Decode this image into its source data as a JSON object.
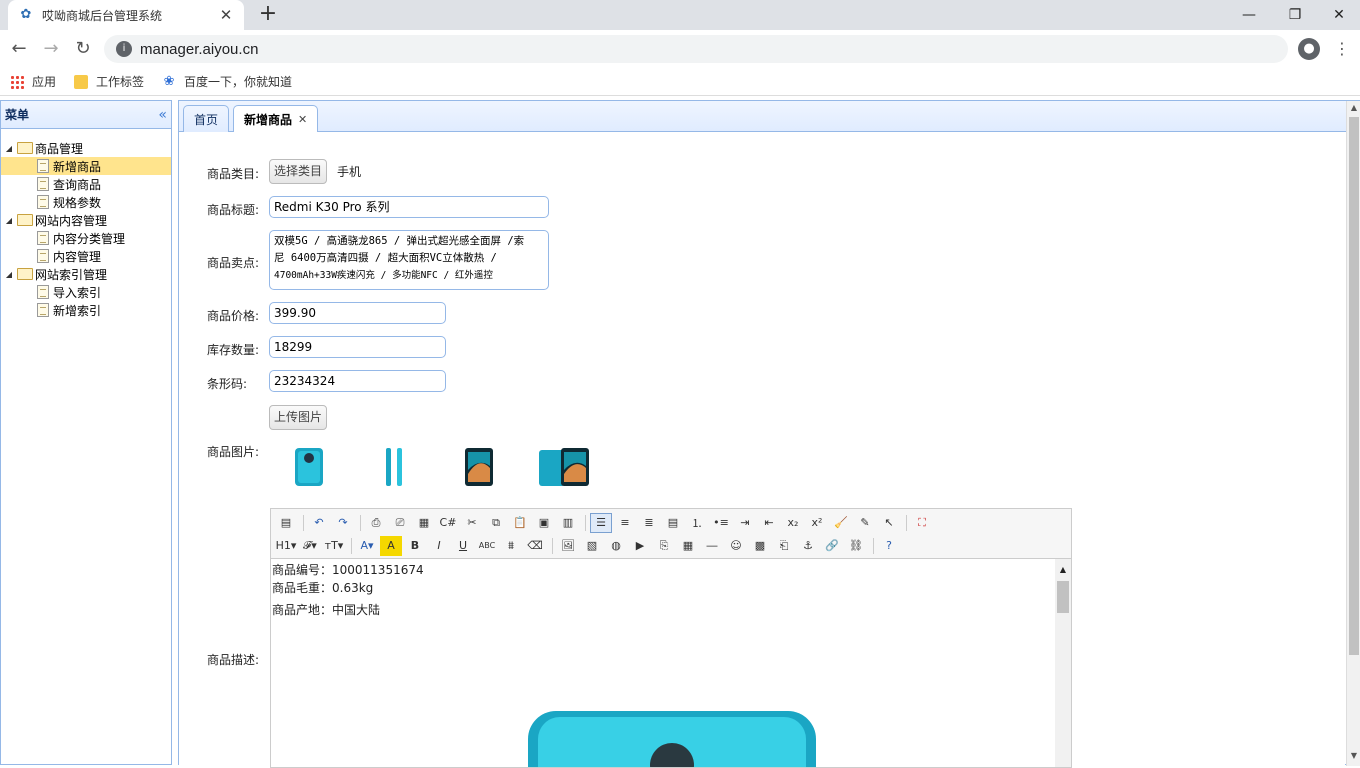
{
  "browser": {
    "tab_title": "哎呦商城后台管理系统",
    "url": "manager.aiyou.cn",
    "bookmarks": [
      {
        "label": "应用",
        "icon": "apps-icon"
      },
      {
        "label": "工作标签",
        "icon": "folder-icon"
      },
      {
        "label": "百度一下，你就知道",
        "icon": "baidu-paw-icon"
      }
    ]
  },
  "menu": {
    "title": "菜单",
    "groups": [
      {
        "label": "商品管理",
        "items": [
          "新增商品",
          "查询商品",
          "规格参数"
        ]
      },
      {
        "label": "网站内容管理",
        "items": [
          "内容分类管理",
          "内容管理"
        ]
      },
      {
        "label": "网站索引管理",
        "items": [
          "导入索引",
          "新增索引"
        ]
      }
    ],
    "selected": "新增商品"
  },
  "tabs": [
    {
      "label": "首页"
    },
    {
      "label": "新增商品",
      "closable": true
    }
  ],
  "form": {
    "category_label": "商品类目:",
    "category_button": "选择类目",
    "category_value": "手机",
    "title_label": "商品标题:",
    "title_value": "Redmi K30 Pro 系列",
    "selling_label": "商品卖点:",
    "selling_line1": "双模5G / 高通骁龙865 / 弹出式超光感全面屏 /索",
    "selling_line2": "尼 6400万高清四摄 / 超大面积VC立体散热 /",
    "selling_line3": "4700mAh+33W疾速闪充 / 多功能NFC / 红外遥控",
    "price_label": "商品价格:",
    "price_value": "399.90",
    "stock_label": "库存数量:",
    "stock_value": "18299",
    "barcode_label": "条形码:",
    "barcode_value": "23234324",
    "upload_button": "上传图片",
    "images_label": "商品图片:",
    "desc_label": "商品描述:"
  },
  "editor": {
    "content": {
      "line1": "商品编号：100011351674",
      "line2": "商品毛重：0.63kg",
      "line3": "商品产地：中国大陆"
    }
  }
}
